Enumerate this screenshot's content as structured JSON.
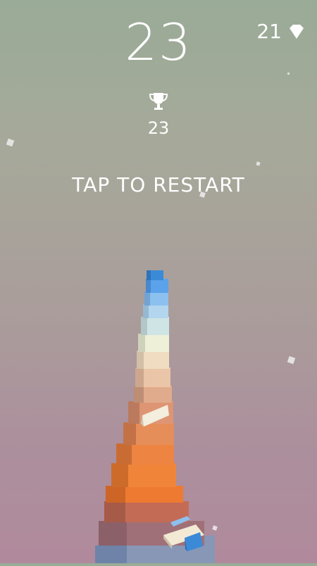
{
  "hud": {
    "score": "23",
    "gems": "21",
    "best_score": "23",
    "gem_icon": "diamond",
    "trophy_icon": "trophy"
  },
  "prompt": {
    "restart": "TAP TO RESTART"
  },
  "colors": {
    "bg_top": "#9aab97",
    "bg_bottom": "#b08a9c",
    "text": "#ffffff",
    "top_block": "#3a8ad8"
  }
}
